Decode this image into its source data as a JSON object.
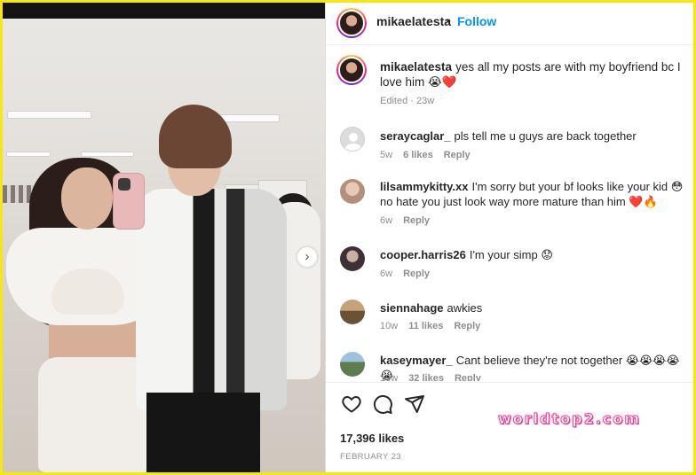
{
  "post": {
    "author": "mikaelatesta",
    "dot": "•",
    "follow_label": "Follow",
    "caption_text": "yes all my posts are with my boyfriend bc I love him 😭❤️",
    "caption_time": "Edited · 23w"
  },
  "comments": [
    {
      "user": "seraycaglar_",
      "text": "pls tell me u guys are back together",
      "time": "5w",
      "likes": "6 likes",
      "reply": "Reply",
      "avatar_color": "#d9d9d9"
    },
    {
      "user": "lilsammykitty.xx",
      "text": "I'm sorry but your bf looks like your kid 😳no hate you just look way more mature than him ❤️🔥",
      "time": "6w",
      "likes": "",
      "reply": "Reply",
      "avatar_color": "#c8a99b"
    },
    {
      "user": "cooper.harris26",
      "text": "I'm your simp 😟",
      "time": "6w",
      "likes": "",
      "reply": "Reply",
      "avatar_color": "#5a4a52"
    },
    {
      "user": "siennahage",
      "text": "awkies",
      "time": "10w",
      "likes": "11 likes",
      "reply": "Reply",
      "avatar_color": "#8a7256"
    },
    {
      "user": "kaseymayer_",
      "text": "Cant believe they're not together 😭😭😭😭😭",
      "time": "10w",
      "likes": "32 likes",
      "reply": "Reply",
      "avatar_color": "#6f8a63"
    }
  ],
  "actions": {
    "icons": [
      "heart-icon",
      "comment-icon",
      "share-icon"
    ],
    "likes_count": "17,396 likes",
    "date": "FEBRUARY 23"
  },
  "watermark": "worldtop2.com",
  "colors": {
    "frame": "#f5e614",
    "link": "#0095f6",
    "muted": "#8e8e8e"
  }
}
